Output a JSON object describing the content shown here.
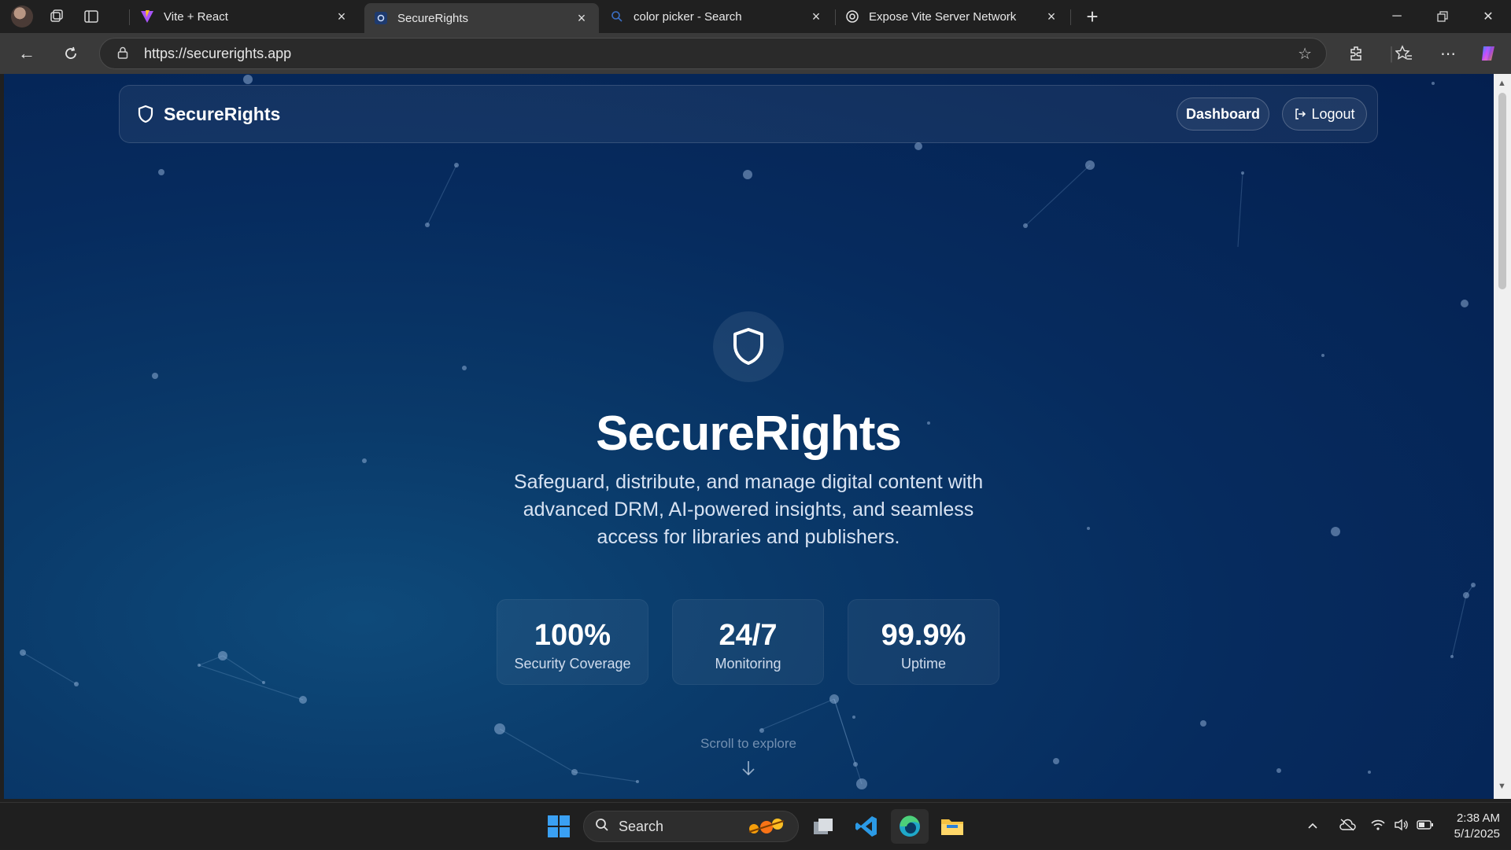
{
  "browser": {
    "tabs": [
      {
        "title": "Vite + React",
        "active": false
      },
      {
        "title": "SecureRights",
        "active": true
      },
      {
        "title": "color picker - Search",
        "active": false
      },
      {
        "title": "Expose Vite Server Network",
        "active": false
      }
    ],
    "url": "https://securerights.app"
  },
  "page": {
    "brand": "SecureRights",
    "nav": {
      "dashboard": "Dashboard",
      "logout": "Logout"
    },
    "hero": {
      "title": "SecureRights",
      "subtitle": "Safeguard, distribute, and manage digital content with advanced DRM, AI-powered insights, and seamless access for libraries and publishers."
    },
    "stats": [
      {
        "value": "100%",
        "label": "Security Coverage"
      },
      {
        "value": "24/7",
        "label": "Monitoring"
      },
      {
        "value": "99.9%",
        "label": "Uptime"
      }
    ],
    "scroll_hint": "Scroll to explore"
  },
  "taskbar": {
    "search_label": "Search",
    "time": "2:38 AM",
    "date": "5/1/2025"
  },
  "colors": {
    "background": "#062b5e",
    "chrome": "#202020",
    "accent": "#ffffff"
  }
}
